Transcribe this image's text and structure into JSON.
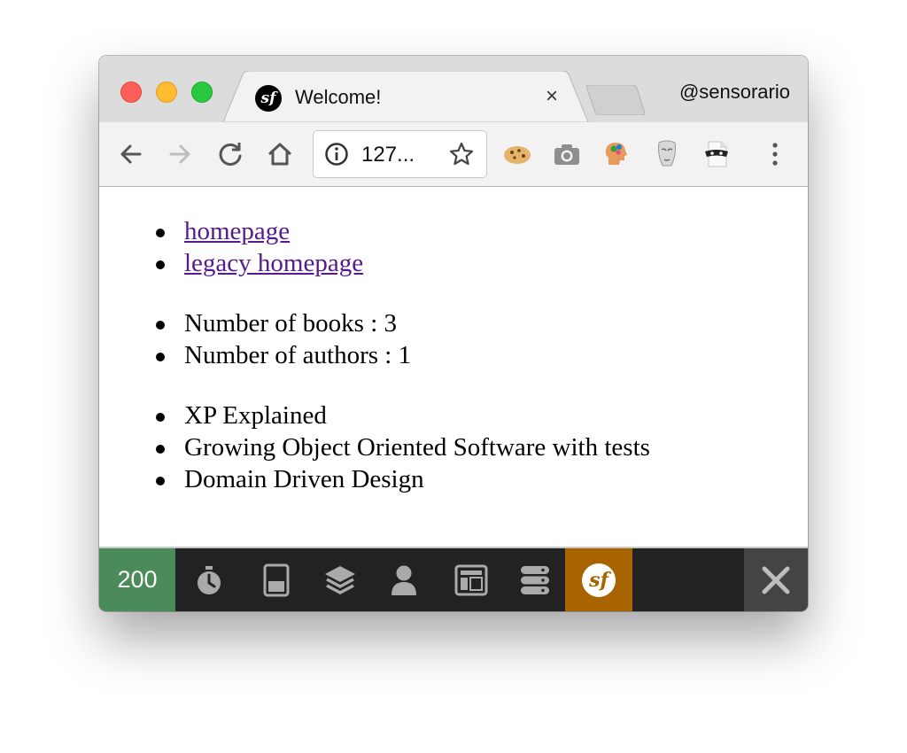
{
  "browser": {
    "tab": {
      "title": "Welcome!",
      "favicon": "symfony-icon",
      "close_glyph": "×"
    },
    "profile_name": "@sensorario",
    "address": {
      "url": "127..."
    },
    "extensions": [
      "cookie-icon",
      "camera-icon",
      "head-gears-icon",
      "mask-icon",
      "bandit-mask-icon"
    ]
  },
  "page": {
    "links": [
      {
        "label": "homepage"
      },
      {
        "label": "legacy homepage"
      }
    ],
    "stats": [
      {
        "text": "Number of books : 3"
      },
      {
        "text": "Number of authors : 1"
      }
    ],
    "books": [
      {
        "title": "XP Explained"
      },
      {
        "title": "Growing Object Oriented Software with tests"
      },
      {
        "title": "Domain Driven Design"
      }
    ]
  },
  "debug_toolbar": {
    "status_code": "200",
    "status_color": "#4b8a59",
    "panels": [
      "timer-icon",
      "memory-icon",
      "layers-icon",
      "user-icon",
      "layout-icon",
      "database-icon"
    ],
    "symfony_color": "#a86400"
  },
  "colors": {
    "link": "#551a8b",
    "titlebar": "#dcdcdc",
    "toolbar": "#f2f2f2",
    "debug_bg": "#222222"
  }
}
